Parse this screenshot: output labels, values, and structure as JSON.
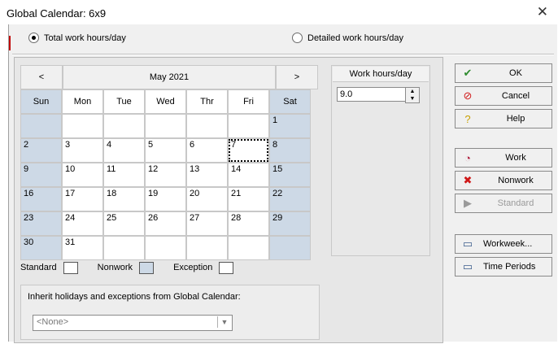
{
  "window": {
    "title": "Global Calendar: 6x9",
    "close_icon": "close-icon"
  },
  "mode": {
    "total_label": "Total work hours/day",
    "detailed_label": "Detailed work hours/day",
    "selected": "total"
  },
  "calendar": {
    "prev": "<",
    "next": ">",
    "month_label": "May 2021",
    "days": [
      "Sun",
      "Mon",
      "Tue",
      "Wed",
      "Thr",
      "Fri",
      "Sat"
    ],
    "weeks": [
      [
        "",
        "",
        "",
        "",
        "",
        "",
        "1"
      ],
      [
        "2",
        "3",
        "4",
        "5",
        "6",
        "7",
        "8"
      ],
      [
        "9",
        "10",
        "11",
        "12",
        "13",
        "14",
        "15"
      ],
      [
        "16",
        "17",
        "18",
        "19",
        "20",
        "21",
        "22"
      ],
      [
        "23",
        "24",
        "25",
        "26",
        "27",
        "28",
        "29"
      ],
      [
        "30",
        "31",
        "",
        "",
        "",
        "",
        ""
      ]
    ],
    "selected_day": "7"
  },
  "legend": {
    "standard": "Standard",
    "nonwork": "Nonwork",
    "exception": "Exception"
  },
  "inherit": {
    "label": "Inherit holidays and exceptions from Global Calendar:",
    "value": "<None>"
  },
  "work_hours": {
    "header": "Work hours/day",
    "value": "9.0"
  },
  "buttons": {
    "ok": "OK",
    "cancel": "Cancel",
    "help": "Help",
    "work": "Work",
    "nonwork": "Nonwork",
    "standard": "Standard",
    "workweek": "Workweek...",
    "time_periods": "Time Periods"
  },
  "colors": {
    "weekend": "#cdd9e6",
    "ok_check": "#2e8b2e",
    "cancel_red": "#d01818",
    "nonwork_x": "#d01818"
  }
}
